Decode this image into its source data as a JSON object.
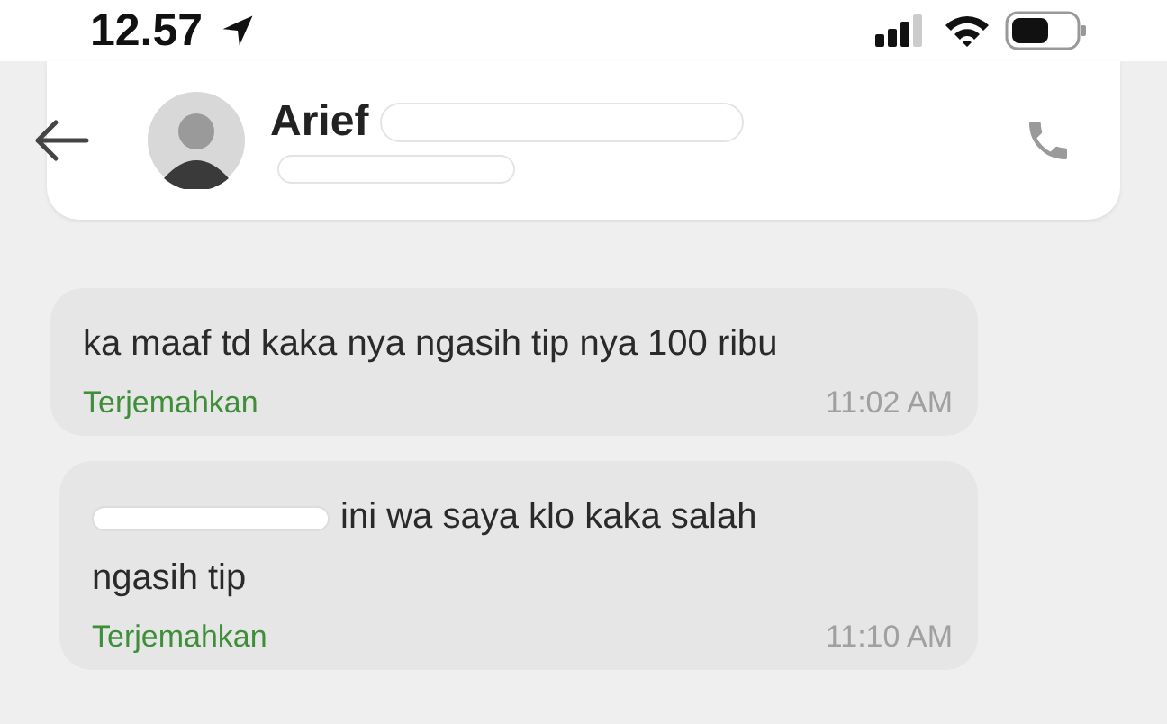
{
  "status_bar": {
    "time": "12.57"
  },
  "header": {
    "contact_name": "Arief"
  },
  "messages": [
    {
      "text": "ka maaf td kaka nya ngasih tip nya 100 ribu",
      "redacted_start": false,
      "translate_link": "Terjemahkan",
      "time": "11:02 AM"
    },
    {
      "text": "ini wa saya klo kaka salah ngasih tip",
      "redacted_start": true,
      "translate_link": "Terjemahkan",
      "time": "11:10 AM"
    }
  ]
}
